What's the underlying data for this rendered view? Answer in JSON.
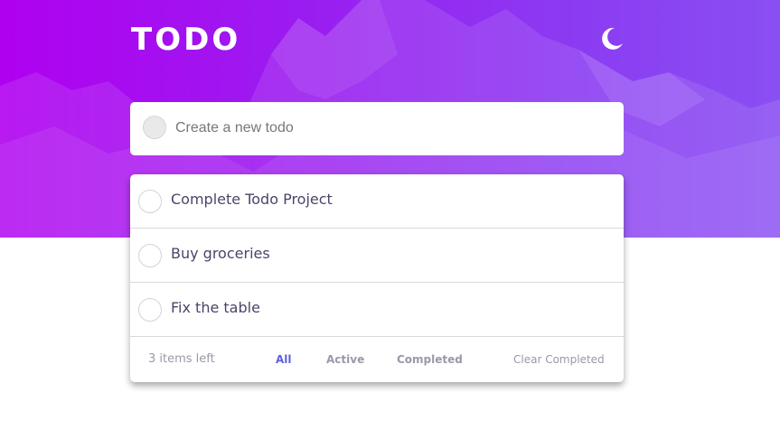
{
  "header": {
    "title": "TODO",
    "theme_toggle_icon": "moon-icon"
  },
  "new_todo": {
    "placeholder": "Create a new todo"
  },
  "todos": [
    {
      "text": "Complete Todo Project",
      "completed": false
    },
    {
      "text": "Buy groceries",
      "completed": false
    },
    {
      "text": "Fix the table",
      "completed": false
    }
  ],
  "footer": {
    "items_left": "3 items left",
    "filters": [
      "All",
      "Active",
      "Completed"
    ],
    "active_filter": "All",
    "clear_label": "Clear Completed"
  },
  "colors": {
    "hero_gradient_start": "#b000f0",
    "hero_gradient_end": "#8a4ff2",
    "active_filter": "#5d5fdc",
    "todo_text": "#4a4568",
    "muted_text": "#9a98ab"
  }
}
